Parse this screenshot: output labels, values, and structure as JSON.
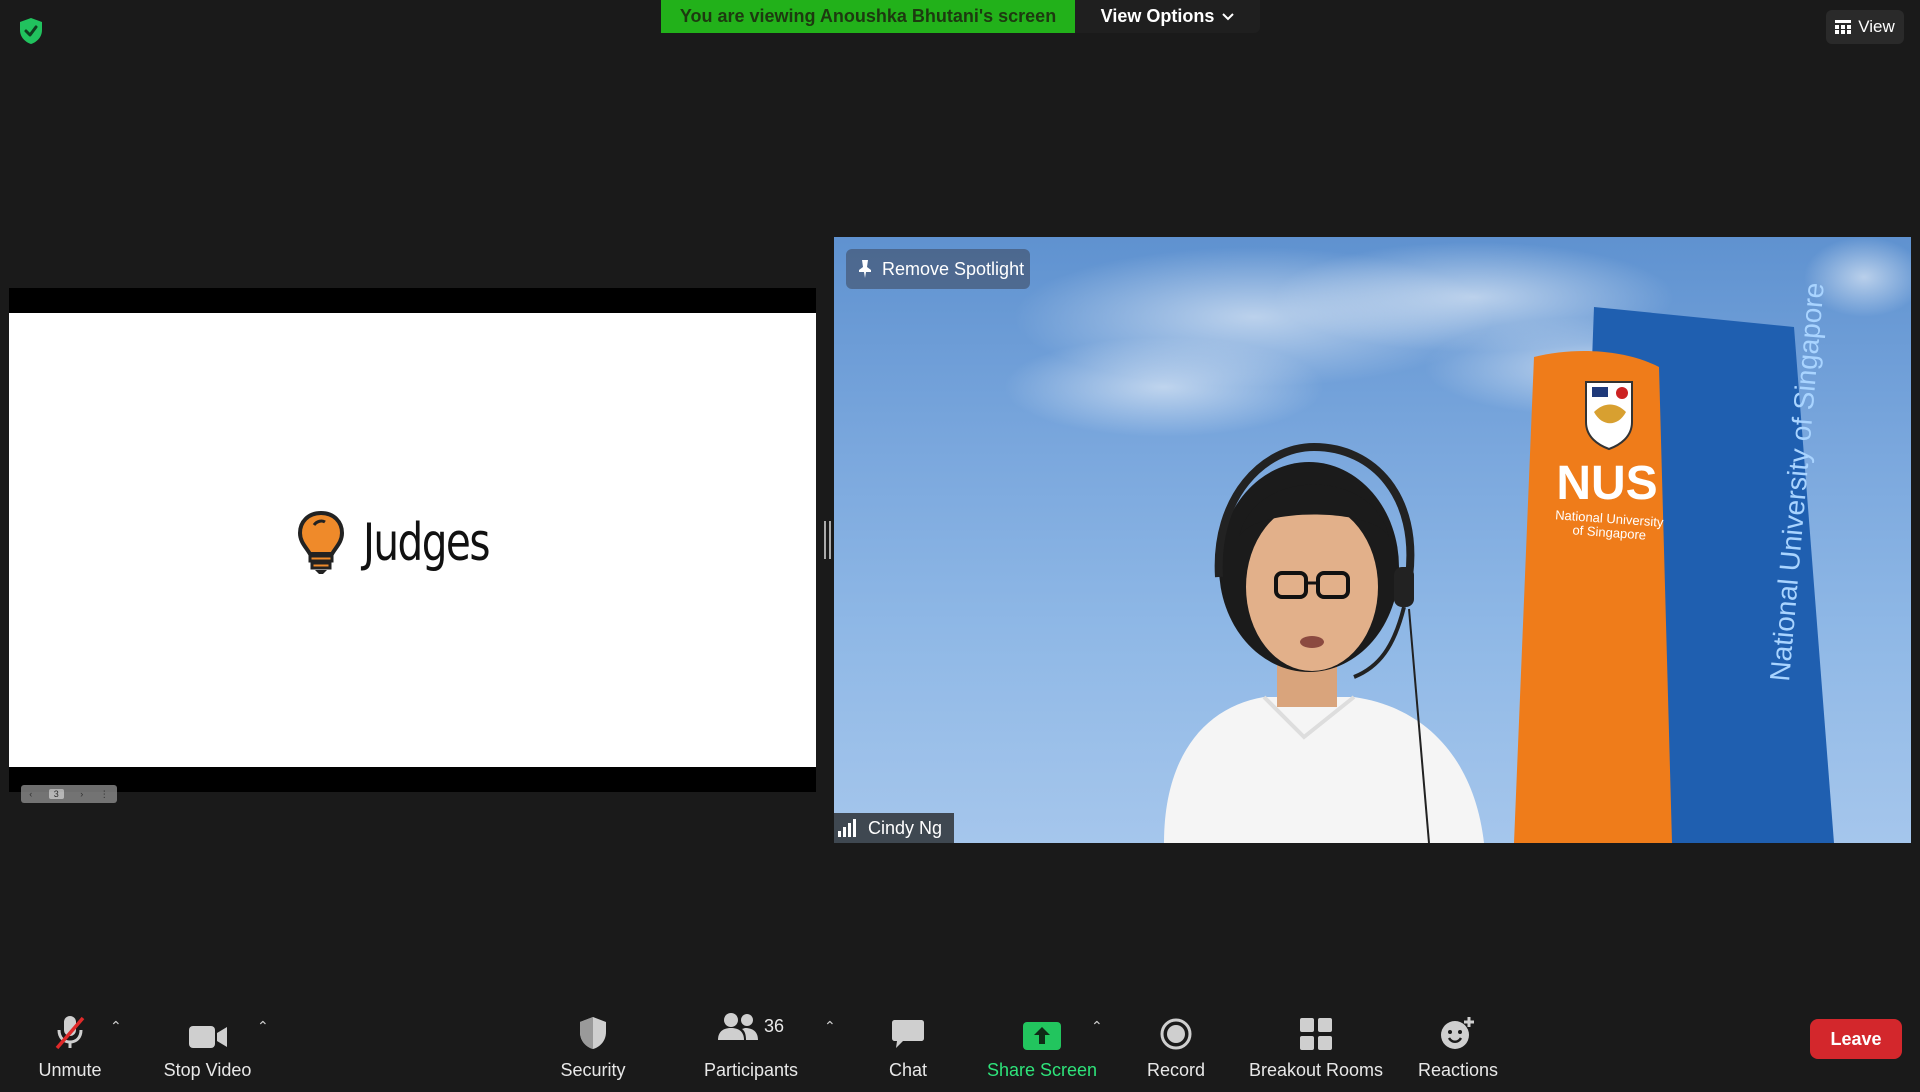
{
  "top_bar": {
    "banner_text": "You are viewing Anoushka Bhutani's screen",
    "view_options_label": "View Options",
    "view_label": "View"
  },
  "shared_screen": {
    "slide_title": "Judges",
    "page_number": "3"
  },
  "video": {
    "remove_spotlight_label": "Remove Spotlight",
    "participant_name": "Cindy Ng",
    "sign_text": "NUS",
    "sign_subtext_line1": "National University",
    "sign_subtext_line2": "of Singapore",
    "banner_text": "National University of Singapore"
  },
  "toolbar": {
    "unmute_label": "Unmute",
    "stop_video_label": "Stop Video",
    "security_label": "Security",
    "participants_label": "Participants",
    "participants_count": "36",
    "chat_label": "Chat",
    "share_screen_label": "Share Screen",
    "record_label": "Record",
    "breakout_rooms_label": "Breakout Rooms",
    "reactions_label": "Reactions",
    "leave_label": "Leave"
  },
  "colors": {
    "banner_green": "#22b11a",
    "share_green": "#2ee37a",
    "leave_red": "#d3272c",
    "nus_orange": "#ef7c1a",
    "nus_blue": "#1f5fb0"
  }
}
